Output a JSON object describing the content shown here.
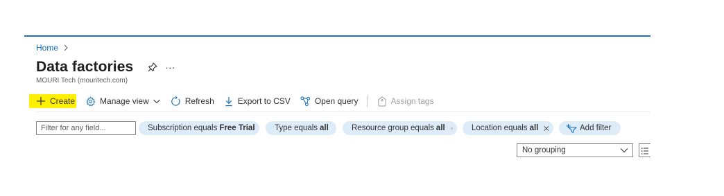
{
  "breadcrumb": {
    "home": "Home"
  },
  "page": {
    "title": "Data factories",
    "subtitle": "MOURI Tech (mouritech.com)",
    "more": "···"
  },
  "toolbar": {
    "create": "Create",
    "manage_view": "Manage view",
    "refresh": "Refresh",
    "export_csv": "Export to CSV",
    "open_query": "Open query",
    "assign_tags": "Assign tags",
    "create_highlight_color": "#fff000"
  },
  "filters": {
    "search_placeholder": "Filter for any field...",
    "subscription": {
      "label": "Subscription equals",
      "value": "Free Trial"
    },
    "type": {
      "label": "Type equals",
      "value": "all"
    },
    "resource_group": {
      "label": "Resource group equals",
      "value": "all"
    },
    "location": {
      "label": "Location equals",
      "value": "all"
    },
    "add_filter": "Add filter"
  },
  "grouping": {
    "selected": "No grouping"
  },
  "colors": {
    "accent": "#0f6cbd",
    "pill": "#deecf9"
  }
}
